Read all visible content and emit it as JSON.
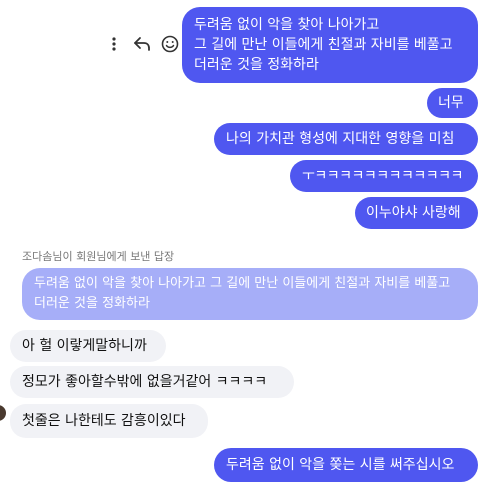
{
  "messages": {
    "out1": {
      "lines": [
        "두려움 없이 악을 찾아 나아가고",
        "그 길에 만난 이들에게 친절과 자비를 베풀고",
        "더러운 것을 정화하라"
      ]
    },
    "out2": "너무",
    "out3": "나의 가치관 형성에 지대한 영향을 미침",
    "out4": "ㅜㅋㅋㅋㅋㅋㅋㅋㅋㅋㅋㅋㅋ",
    "out5": "이누야샤 사랑해",
    "reply_header": "조다솜님이 회원님에게 보낸 답장",
    "quoted": "두려움 없이 악을 찾아 나아가고 그 길에 만난 이들에게 친절과 자비를 베풀고 더러운 것을 정화하라",
    "in1": "아 헐 이랗게말하니까",
    "in2": "정모가 좋아할수밖에 없을거같어 ㅋㅋㅋㅋ",
    "in3": "첫줄은 나한테도 감흥이있다",
    "out6": "두려움 없이 악을 쫒는 시를 써주십시오"
  },
  "icons": {
    "more": "more-vertical-icon",
    "reply": "reply-icon",
    "react": "smiley-icon"
  },
  "colors": {
    "outgoing": "#4f57f0",
    "incoming": "#f1f2f6",
    "quoted": "#a6aef8"
  }
}
